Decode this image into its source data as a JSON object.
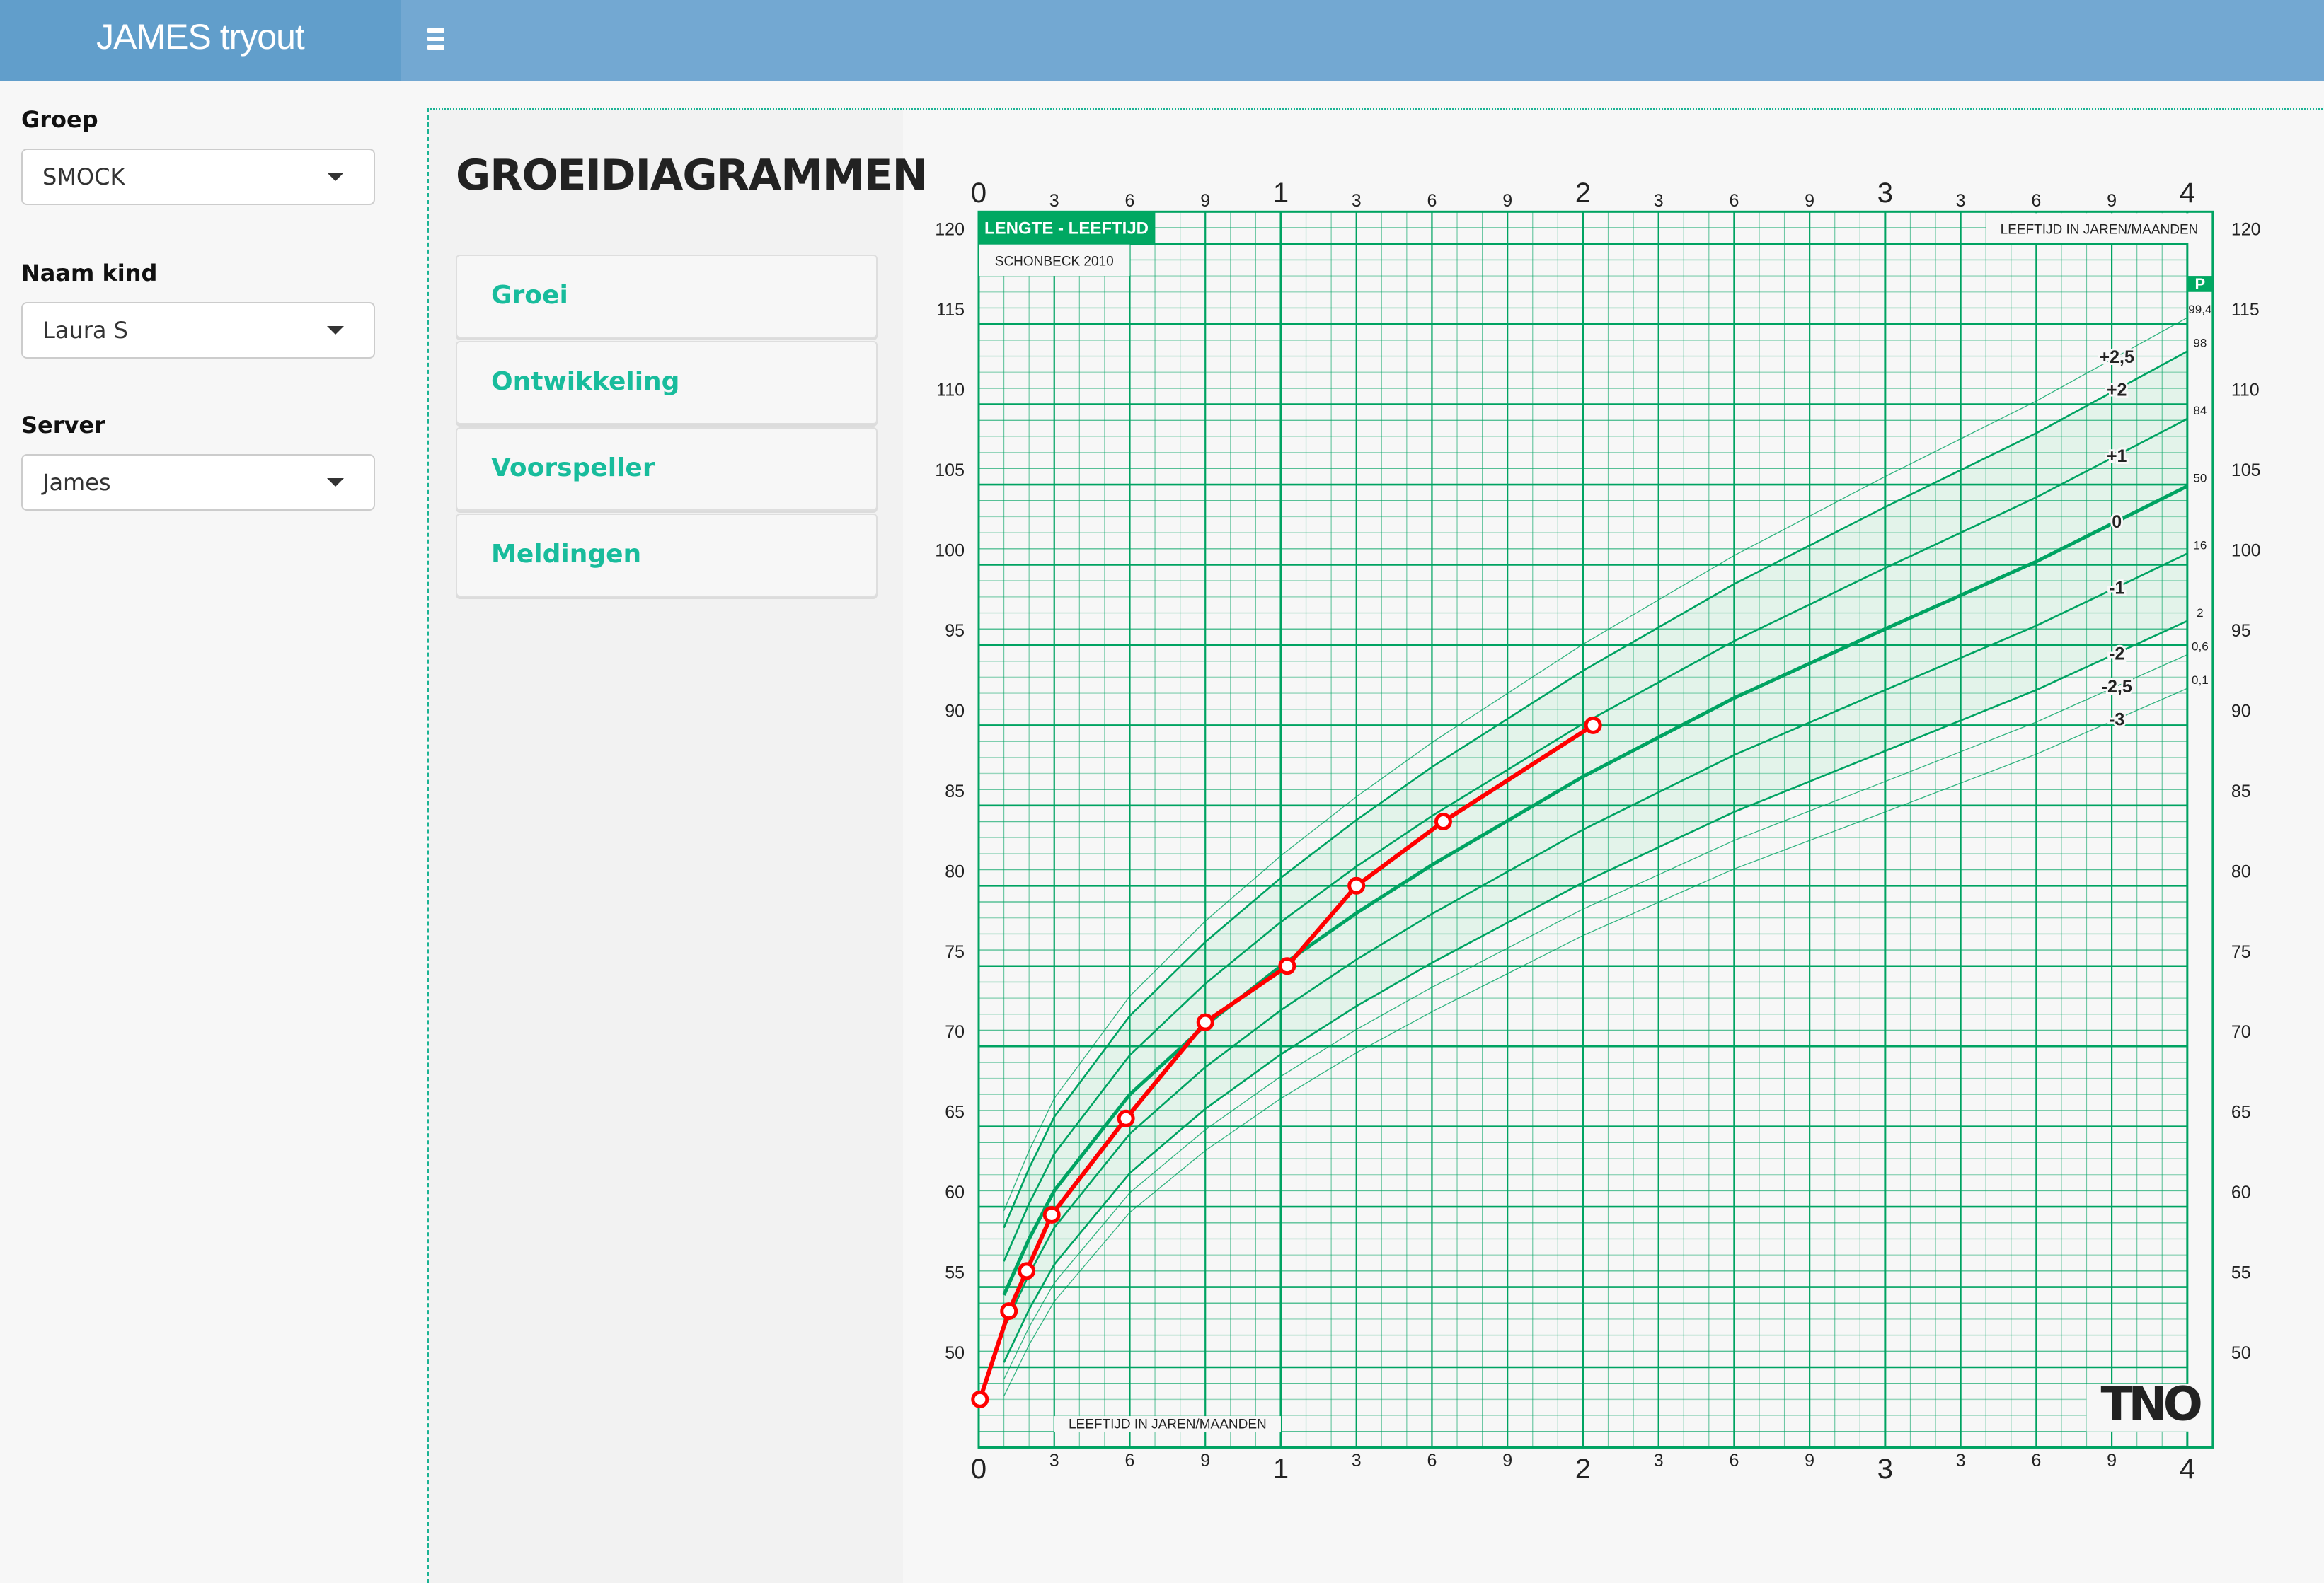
{
  "app": {
    "title": "JAMES tryout",
    "menu_icon": "hamburger-icon"
  },
  "sidebar": {
    "fields": [
      {
        "label": "Groep",
        "value": "SMOCK"
      },
      {
        "label": "Naam kind",
        "value": "Laura S"
      },
      {
        "label": "Server",
        "value": "James"
      }
    ]
  },
  "main": {
    "title": "GROEIDIAGRAMMEN",
    "nav": [
      {
        "label": "Groei"
      },
      {
        "label": "Ontwikkeling"
      },
      {
        "label": "Voorspeller"
      },
      {
        "label": "Meldingen"
      }
    ]
  },
  "colors": {
    "accent": "#18bc9c",
    "grid": "#00a362",
    "band": "#e3f3ea",
    "child_line": "#ff0000",
    "topbar": "#73a8d2",
    "brand": "#619ecb"
  },
  "chart_data": {
    "type": "line",
    "title": "LENGTE - LEEFTIJD",
    "subtitle": "SCHONBECK 2010",
    "xlabel": "LEEFTIJD IN JAREN/MAANDEN",
    "ylabel": "",
    "xunit": "months",
    "xlim": [
      0,
      48
    ],
    "ylim": [
      45,
      122
    ],
    "grid": true,
    "x_major_ticks": [
      {
        "month": 0,
        "label": "0",
        "major": true
      },
      {
        "month": 3,
        "label": "3"
      },
      {
        "month": 6,
        "label": "6"
      },
      {
        "month": 9,
        "label": "9"
      },
      {
        "month": 12,
        "label": "1",
        "major": true
      },
      {
        "month": 15,
        "label": "3"
      },
      {
        "month": 18,
        "label": "6"
      },
      {
        "month": 21,
        "label": "9"
      },
      {
        "month": 24,
        "label": "2",
        "major": true
      },
      {
        "month": 27,
        "label": "3"
      },
      {
        "month": 30,
        "label": "6"
      },
      {
        "month": 33,
        "label": "9"
      },
      {
        "month": 36,
        "label": "3",
        "major": true
      },
      {
        "month": 39,
        "label": "3"
      },
      {
        "month": 42,
        "label": "6"
      },
      {
        "month": 45,
        "label": "9"
      },
      {
        "month": 48,
        "label": "4",
        "major": true
      }
    ],
    "y_ticks": [
      50,
      55,
      60,
      65,
      70,
      75,
      80,
      85,
      90,
      95,
      100,
      105,
      110,
      115,
      120
    ],
    "percentile_header": "P",
    "reference_ages": [
      1,
      2,
      3,
      6,
      9,
      12,
      15,
      18,
      24,
      30,
      36,
      42,
      48
    ],
    "reference_median": [
      54.5,
      58.0,
      61.0,
      67.0,
      71.3,
      75.0,
      78.3,
      81.3,
      86.8,
      91.7,
      96.0,
      100.2,
      104.9
    ],
    "reference_sd": [
      2.1,
      2.2,
      2.3,
      2.45,
      2.6,
      2.75,
      2.9,
      3.05,
      3.3,
      3.55,
      3.8,
      4.0,
      4.2
    ],
    "sd_lines": [
      {
        "z": 2.5,
        "label": "+2,5",
        "percentile": "99,4",
        "weight": "thin"
      },
      {
        "z": 2,
        "label": "+2",
        "percentile": "98",
        "weight": "normal"
      },
      {
        "z": 1,
        "label": "+1",
        "percentile": "84",
        "weight": "normal"
      },
      {
        "z": 0,
        "label": "0",
        "percentile": "50",
        "weight": "bold"
      },
      {
        "z": -1,
        "label": "-1",
        "percentile": "16",
        "weight": "normal"
      },
      {
        "z": -2,
        "label": "-2",
        "percentile": "2",
        "weight": "normal"
      },
      {
        "z": -2.5,
        "label": "-2,5",
        "percentile": "0,6",
        "weight": "thin"
      },
      {
        "z": -3,
        "label": "-3",
        "percentile": "0,1",
        "weight": "thin"
      }
    ],
    "shaded_band_z": [
      -2,
      2
    ],
    "series": [
      {
        "name": "Laura S",
        "color": "#ff0000",
        "points": [
          {
            "age_months": 0.05,
            "height_cm": 48.0
          },
          {
            "age_months": 1.2,
            "height_cm": 53.5
          },
          {
            "age_months": 1.9,
            "height_cm": 56.0
          },
          {
            "age_months": 2.9,
            "height_cm": 59.5
          },
          {
            "age_months": 5.85,
            "height_cm": 65.5
          },
          {
            "age_months": 9.0,
            "height_cm": 71.5
          },
          {
            "age_months": 12.25,
            "height_cm": 75.0
          },
          {
            "age_months": 15.0,
            "height_cm": 80.0
          },
          {
            "age_months": 18.45,
            "height_cm": 84.0
          },
          {
            "age_months": 24.4,
            "height_cm": 90.0
          }
        ]
      }
    ],
    "logo": "TNO"
  }
}
